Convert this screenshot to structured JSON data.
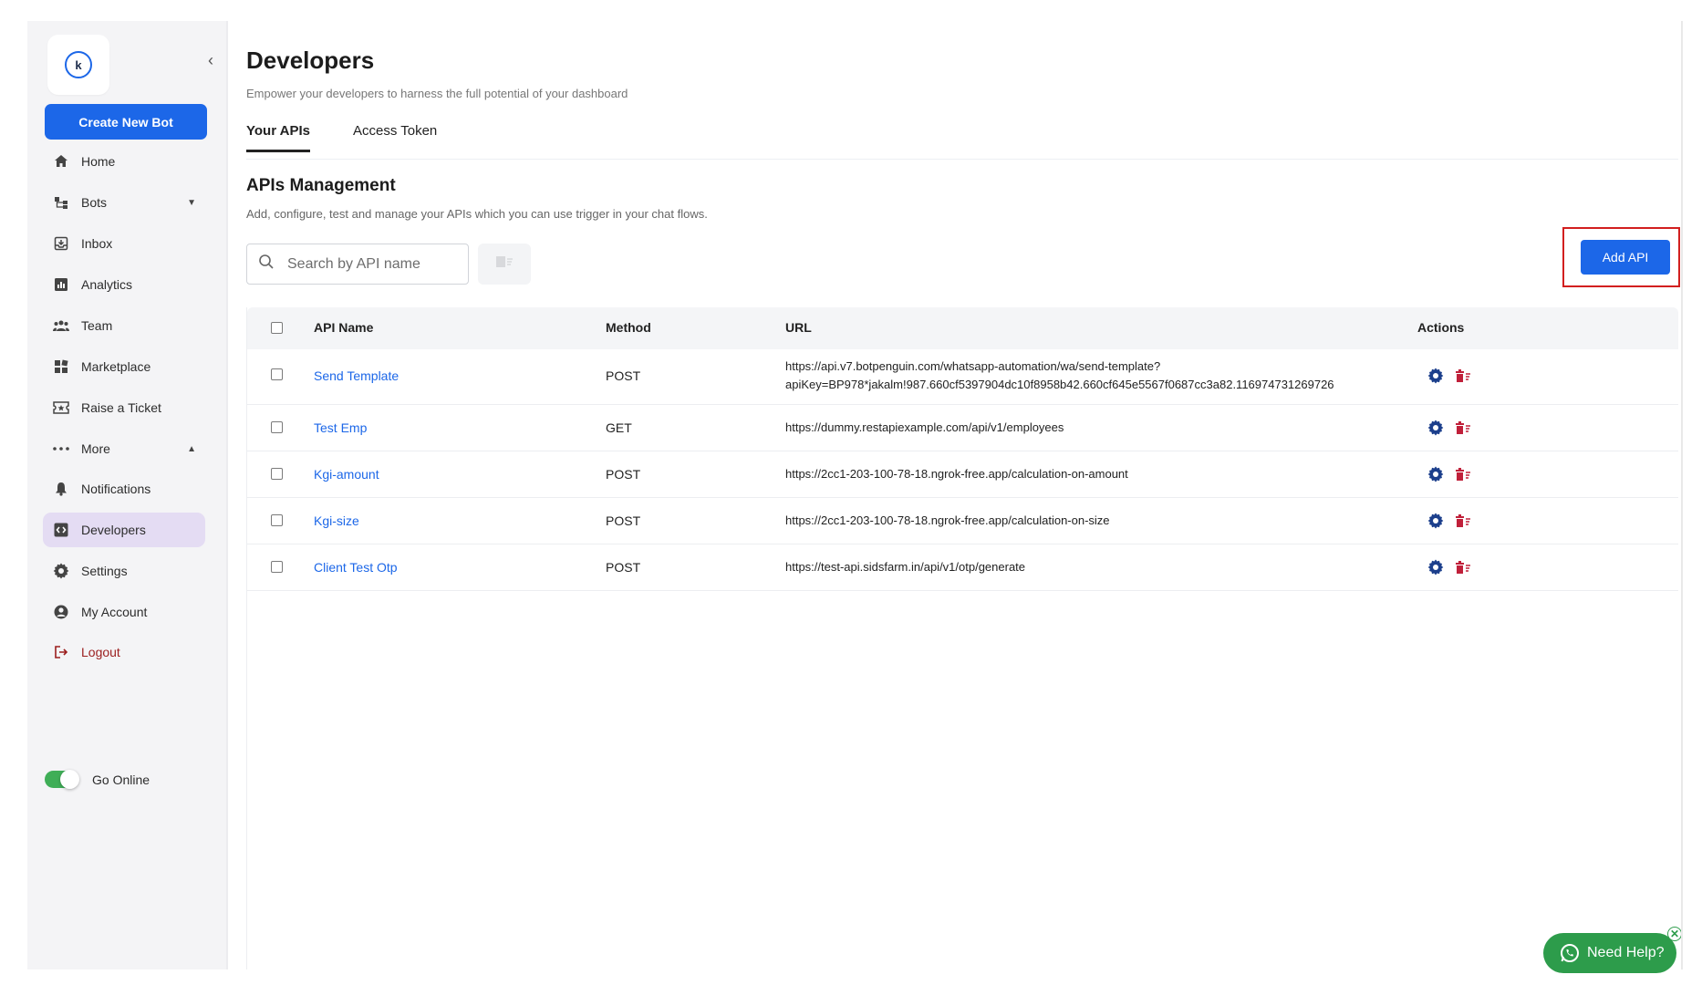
{
  "sidebar": {
    "logo_letter": "k",
    "create_bot_label": "Create New Bot",
    "items": [
      {
        "label": "Home",
        "icon": "home-icon"
      },
      {
        "label": "Bots",
        "icon": "bots-icon"
      },
      {
        "label": "Inbox",
        "icon": "inbox-icon"
      },
      {
        "label": "Analytics",
        "icon": "analytics-icon"
      },
      {
        "label": "Team",
        "icon": "team-icon"
      },
      {
        "label": "Marketplace",
        "icon": "marketplace-icon"
      },
      {
        "label": "Raise a Ticket",
        "icon": "ticket-icon"
      },
      {
        "label": "More",
        "icon": "more-icon"
      },
      {
        "label": "Notifications",
        "icon": "bell-icon"
      },
      {
        "label": "Developers",
        "icon": "code-icon"
      },
      {
        "label": "Settings",
        "icon": "gear-icon"
      },
      {
        "label": "My Account",
        "icon": "account-icon"
      },
      {
        "label": "Logout",
        "icon": "logout-icon"
      }
    ],
    "go_online_label": "Go Online",
    "go_online_on": true
  },
  "header": {
    "title": "Developers",
    "subtitle": "Empower your developers to harness the full potential of your dashboard"
  },
  "tabs": [
    {
      "label": "Your APIs",
      "active": true
    },
    {
      "label": "Access Token",
      "active": false
    }
  ],
  "section": {
    "title": "APIs Management",
    "subtitle": "Add, configure, test and manage your APIs which you can use trigger in your chat flows."
  },
  "search": {
    "placeholder": "Search by API name",
    "value": ""
  },
  "add_api_label": "Add API",
  "table": {
    "columns": [
      "API Name",
      "Method",
      "URL",
      "Actions"
    ],
    "rows": [
      {
        "name": "Send Template",
        "method": "POST",
        "url_line1": "https://api.v7.botpenguin.com/whatsapp-automation/wa/send-template?",
        "url_line2": "apiKey=BP978*jakalm!987.660cf5397904dc10f8958b42.660cf645e5567f0687cc3a82.116974731269726"
      },
      {
        "name": "Test Emp",
        "method": "GET",
        "url_line1": "https://dummy.restapiexample.com/api/v1/employees",
        "url_line2": ""
      },
      {
        "name": "Kgi-amount",
        "method": "POST",
        "url_line1": "https://2cc1-203-100-78-18.ngrok-free.app/calculation-on-amount",
        "url_line2": ""
      },
      {
        "name": "Kgi-size",
        "method": "POST",
        "url_line1": "https://2cc1-203-100-78-18.ngrok-free.app/calculation-on-size",
        "url_line2": ""
      },
      {
        "name": "Client Test Otp",
        "method": "POST",
        "url_line1": "https://test-api.sidsfarm.in/api/v1/otp/generate",
        "url_line2": ""
      }
    ]
  },
  "help_label": "Need Help?",
  "help_close": "✕",
  "colors": {
    "primary": "#1c67e8",
    "danger": "#c0203a",
    "settings_icon": "#1c3f8c",
    "help_green": "#2d9c4b",
    "highlight": "#d21f1f"
  }
}
